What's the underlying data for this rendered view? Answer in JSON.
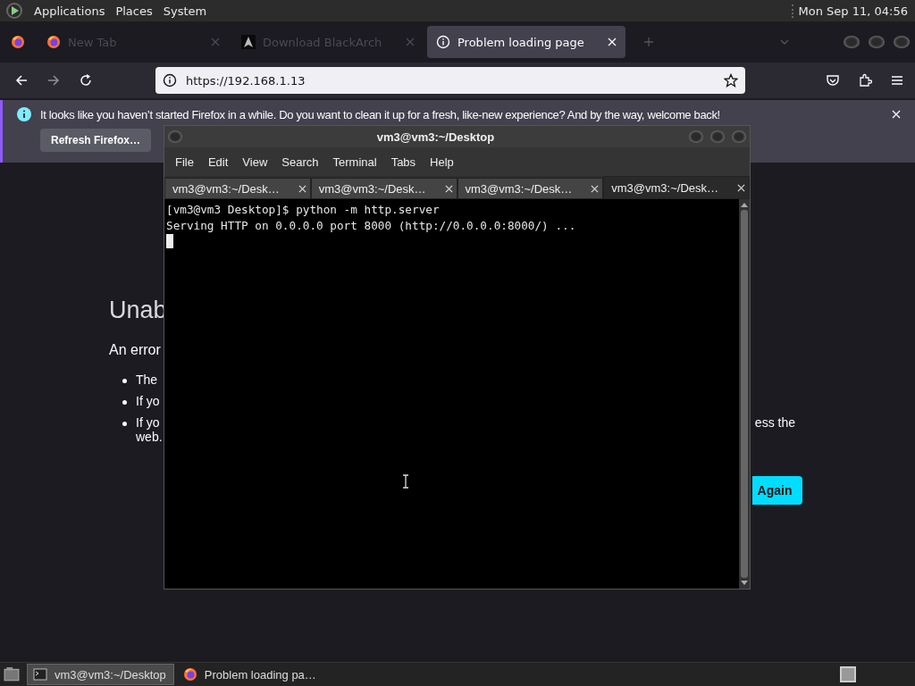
{
  "top_panel": {
    "menus": [
      "Applications",
      "Places",
      "System"
    ],
    "clock": "Mon Sep 11, 04:56"
  },
  "browser": {
    "tabs": [
      {
        "title": "New Tab",
        "selected": false
      },
      {
        "title": "Download BlackArch",
        "selected": false
      },
      {
        "title": "Problem loading page",
        "selected": true
      }
    ],
    "url": "https://192.168.1.13",
    "notification": {
      "message": "It looks like you haven’t started Firefox in a while. Do you want to clean it up for a fresh, like-new experience? And by the way, welcome back!",
      "button": "Refresh Firefox…"
    },
    "page": {
      "heading": "Unab",
      "intro": "An error",
      "bullets": [
        {
          "text": "The"
        },
        {
          "text": "If yo"
        },
        {
          "text": "If yo",
          "continuation": "web.",
          "right": "ess the"
        }
      ],
      "button": "Again"
    }
  },
  "terminal": {
    "title": "vm3@vm3:~/Desktop",
    "menus": [
      "File",
      "Edit",
      "View",
      "Search",
      "Terminal",
      "Tabs",
      "Help"
    ],
    "tabs": [
      {
        "title": "vm3@vm3:~/Desk…",
        "selected": false
      },
      {
        "title": "vm3@vm3:~/Desk…",
        "selected": false
      },
      {
        "title": "vm3@vm3:~/Desk…",
        "selected": false
      },
      {
        "title": "vm3@vm3:~/Desk…",
        "selected": true
      }
    ],
    "lines": [
      "[vm3@vm3 Desktop]$ python -m http.server",
      "Serving HTTP on 0.0.0.0 port 8000 (http://0.0.0.0:8000/) ..."
    ]
  },
  "taskbar": {
    "items": [
      {
        "title": "vm3@vm3:~/Desktop",
        "selected": true
      },
      {
        "title": "Problem loading pa…",
        "selected": false
      }
    ]
  }
}
